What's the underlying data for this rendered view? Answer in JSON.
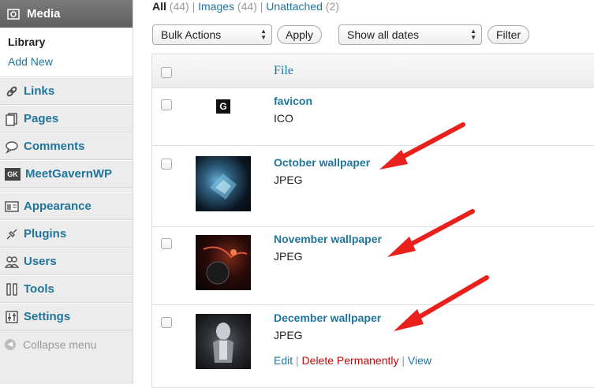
{
  "sidebar": {
    "media_label": "Media",
    "submenu": [
      "Library",
      "Add New"
    ],
    "items": [
      {
        "label": "Links",
        "icon": "links-icon"
      },
      {
        "label": "Pages",
        "icon": "pages-icon"
      },
      {
        "label": "Comments",
        "icon": "comments-icon"
      },
      {
        "label": "MeetGavernWP",
        "icon": "gk-icon",
        "badge": "GK"
      },
      {
        "label": "Appearance",
        "icon": "appearance-icon"
      },
      {
        "label": "Plugins",
        "icon": "plugins-icon"
      },
      {
        "label": "Users",
        "icon": "users-icon"
      },
      {
        "label": "Tools",
        "icon": "tools-icon"
      },
      {
        "label": "Settings",
        "icon": "settings-icon"
      }
    ],
    "collapse_label": "Collapse menu"
  },
  "filters": {
    "all": "All",
    "all_count": "(44)",
    "images": "Images",
    "images_count": "(44)",
    "unattached": "Unattached",
    "unattached_count": "(2)"
  },
  "toolbar": {
    "bulk_actions": "Bulk Actions",
    "apply": "Apply",
    "dates": "Show all dates",
    "filter": "Filter"
  },
  "table": {
    "header_file": "File",
    "rows": [
      {
        "title": "favicon",
        "type": "ICO",
        "thumb_letter": "G"
      },
      {
        "title": "October wallpaper",
        "type": "JPEG"
      },
      {
        "title": "November wallpaper",
        "type": "JPEG"
      },
      {
        "title": "December wallpaper",
        "type": "JPEG",
        "actions": {
          "edit": "Edit",
          "delete": "Delete Permanently",
          "view": "View"
        }
      }
    ]
  },
  "colors": {
    "link": "#21759b",
    "arrow": "#e8211d",
    "delete": "#bc0b0b"
  }
}
